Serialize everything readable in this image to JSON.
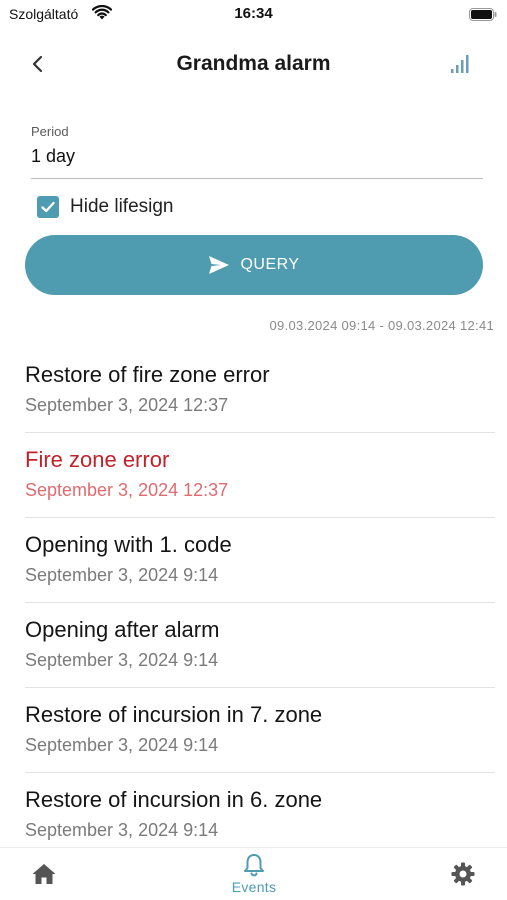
{
  "status_bar": {
    "carrier": "Szolgáltató",
    "time": "16:34"
  },
  "nav": {
    "title": "Grandma alarm"
  },
  "filter": {
    "period_label": "Period",
    "period_value": "1 day",
    "hide_lifesign_label": "Hide lifesign",
    "hide_lifesign_checked": true,
    "query_label": "QUERY",
    "date_range": "09.03.2024 09:14 - 09.03.2024 12:41"
  },
  "events": [
    {
      "title": "Restore of fire zone error",
      "time": "September 3, 2024 12:37",
      "type": "normal"
    },
    {
      "title": "Fire zone error",
      "time": "September 3, 2024 12:37",
      "type": "error"
    },
    {
      "title": "Opening with 1. code",
      "time": "September 3, 2024 9:14",
      "type": "normal"
    },
    {
      "title": "Opening after alarm",
      "time": "September 3, 2024 9:14",
      "type": "normal"
    },
    {
      "title": "Restore of incursion in 7. zone",
      "time": "September 3, 2024 9:14",
      "type": "normal"
    },
    {
      "title": "Restore of incursion in 6. zone",
      "time": "September 3, 2024 9:14",
      "type": "normal"
    }
  ],
  "tab_bar": {
    "events_label": "Events"
  },
  "colors": {
    "accent": "#4f9bb0",
    "error": "#c0242b",
    "error_time": "#df6b6f"
  },
  "icons": {
    "back": "chevron-left-icon",
    "signal": "signal-bars-icon",
    "send": "send-icon",
    "home": "home-icon",
    "events": "bell-icon",
    "settings": "gear-icon"
  }
}
